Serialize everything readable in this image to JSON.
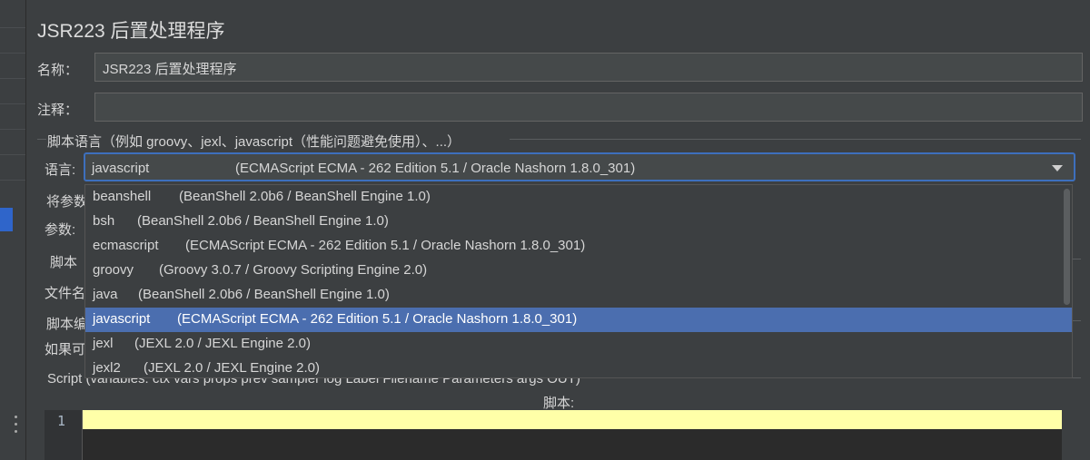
{
  "title": "JSR223 后置处理程序",
  "name": {
    "label": "名称：",
    "value": "JSR223 后置处理程序"
  },
  "comment": {
    "label": "注释：",
    "value": ""
  },
  "script_language_section": {
    "title": "脚本语言（例如 groovy、jexl、javascript（性能问题避免使用）、...）"
  },
  "language": {
    "label": "语言:",
    "selected_name": "javascript",
    "selected_desc": "(ECMAScript ECMA - 262 Edition 5.1 / Oracle Nashorn 1.8.0_301)"
  },
  "dropdown_options": [
    {
      "name": "beanshell",
      "desc": "(BeanShell 2.0b6 / BeanShell Engine 1.0)"
    },
    {
      "name": "bsh",
      "desc": "(BeanShell 2.0b6 / BeanShell Engine 1.0)"
    },
    {
      "name": "ecmascript",
      "desc": "(ECMAScript ECMA - 262 Edition 5.1 / Oracle Nashorn 1.8.0_301)"
    },
    {
      "name": "groovy",
      "desc": "(Groovy 3.0.7 / Groovy Scripting Engine 2.0)"
    },
    {
      "name": "java",
      "desc": "(BeanShell 2.0b6 / BeanShell Engine 1.0)"
    },
    {
      "name": "javascript",
      "desc": "(ECMAScript ECMA - 262 Edition 5.1 / Oracle Nashorn 1.8.0_301)"
    },
    {
      "name": "jexl",
      "desc": "(JEXL 2.0 / JEXL Engine 2.0)"
    },
    {
      "name": "jexl2",
      "desc": "(JEXL 2.0 / JEXL Engine 2.0)"
    }
  ],
  "partial_labels": {
    "pass_params": "将参数",
    "params": "参数:",
    "script_file_section": "脚本",
    "filename": "文件名",
    "script_compile_section": "脚本编",
    "if_available": "如果可"
  },
  "script_section": {
    "title": "Script (variables: ctx vars props prev sampler log Label Filename Parameters args OUT)"
  },
  "script_label": "脚本:",
  "editor": {
    "line_number": "1"
  },
  "colors": {
    "background": "#3c3f41",
    "selection": "#4b6eaf",
    "focus_border": "#3d6fbd",
    "current_line": "#ffffa8"
  }
}
